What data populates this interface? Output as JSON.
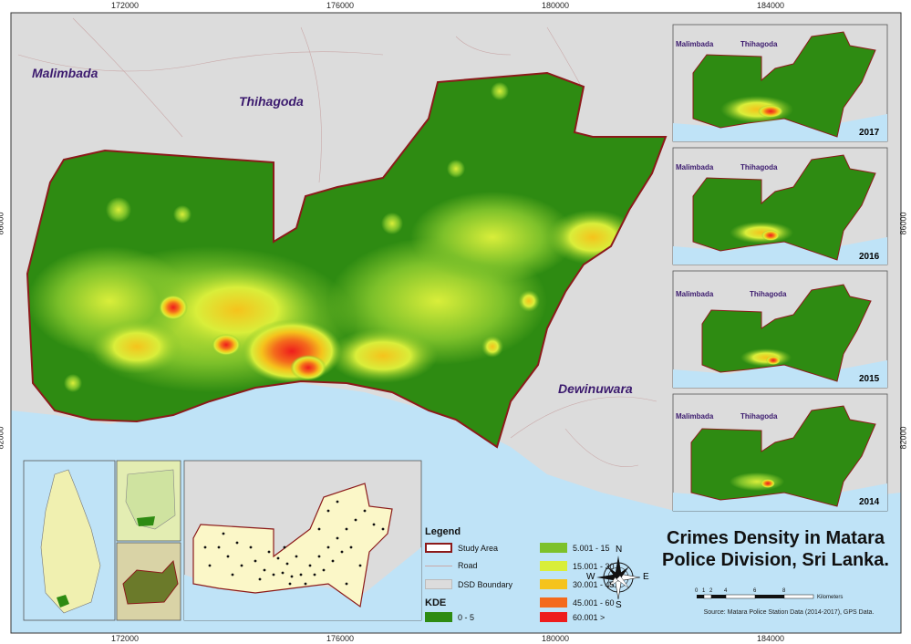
{
  "title_line1": "Crimes Density in Matara",
  "title_line2": "Police Division, Sri Lanka.",
  "x_ticks": [
    "172000",
    "176000",
    "180000",
    "184000"
  ],
  "y_ticks": [
    "86000",
    "82000"
  ],
  "regions": {
    "malimbada": "Malimbada",
    "thihagoda": "Thihagoda",
    "dewinuwara": "Dewinuwara"
  },
  "insets": [
    {
      "year": "2017",
      "left": "Malimbada",
      "right": "Thihagoda"
    },
    {
      "year": "2016",
      "left": "Malimbada",
      "right": "Thihagoda"
    },
    {
      "year": "2015",
      "left": "Malimbada",
      "right": "Thihagoda"
    },
    {
      "year": "2014",
      "left": "Malimbada",
      "right": "Thihagoda"
    }
  ],
  "legend": {
    "title": "Legend",
    "study_area": "Study Area",
    "road": "Road",
    "dsd_boundary": "DSD Boundary",
    "kde_title": "KDE",
    "classes": [
      {
        "label": "0 - 5",
        "color": "#2e8b12"
      },
      {
        "label": "5.001 - 15",
        "color": "#7dc12a"
      },
      {
        "label": "15.001 - 30",
        "color": "#d9ee3a"
      },
      {
        "label": "30.001 - 45",
        "color": "#f5c31c"
      },
      {
        "label": "45.001 - 60",
        "color": "#f46a1c"
      },
      {
        "label": "60.001 >",
        "color": "#ee1c1c"
      }
    ]
  },
  "compass": {
    "n": "N",
    "s": "S",
    "e": "E",
    "w": "W"
  },
  "scale": {
    "ticks": [
      "0",
      "1",
      "2",
      "4",
      "6",
      "8"
    ],
    "unit": "Kilometers"
  },
  "source": "Source: Matara Police Station Data (2014-2017), GPS Data.",
  "colors": {
    "sea": "#bfe3f7",
    "land": "#dcdcdc",
    "study": "#2e8b12",
    "boundary": "#8b1a1a"
  }
}
